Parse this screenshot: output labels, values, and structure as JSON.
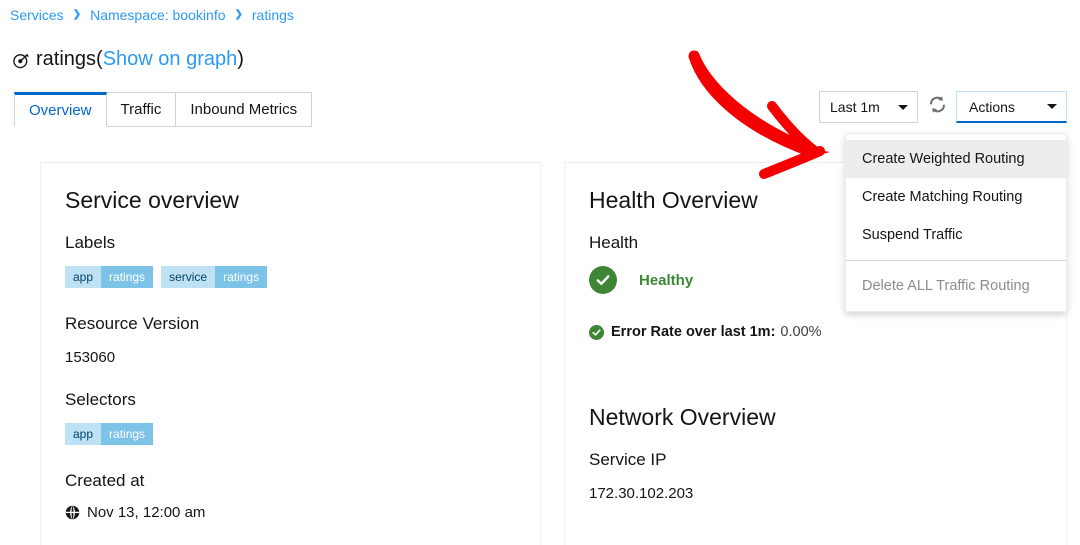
{
  "breadcrumb": {
    "items": [
      {
        "label": "Services"
      },
      {
        "label": "Namespace: bookinfo"
      },
      {
        "label": "ratings"
      }
    ],
    "separator": "❯"
  },
  "header": {
    "icon": "service-node-icon",
    "name": "ratings",
    "paren_open": "(",
    "graph_link": "Show on graph",
    "paren_close": ")"
  },
  "tabs": [
    {
      "label": "Overview",
      "active": true
    },
    {
      "label": "Traffic",
      "active": false
    },
    {
      "label": "Inbound Metrics",
      "active": false
    }
  ],
  "toolbar": {
    "time_range": "Last 1m",
    "refresh_icon": "refresh-icon",
    "actions_label": "Actions"
  },
  "actions_menu": {
    "items": [
      {
        "label": "Create Weighted Routing",
        "state": "hovered"
      },
      {
        "label": "Create Matching Routing",
        "state": "normal"
      },
      {
        "label": "Suspend Traffic",
        "state": "normal"
      },
      {
        "label": "Delete ALL Traffic Routing",
        "state": "disabled"
      }
    ]
  },
  "service_overview": {
    "title": "Service overview",
    "labels_title": "Labels",
    "labels": [
      {
        "key": "app",
        "value": "ratings"
      },
      {
        "key": "service",
        "value": "ratings"
      }
    ],
    "resource_version_title": "Resource Version",
    "resource_version": "153060",
    "selectors_title": "Selectors",
    "selectors": [
      {
        "key": "app",
        "value": "ratings"
      }
    ],
    "created_at_title": "Created at",
    "created_at": "Nov 13, 12:00 am",
    "created_at_icon": "globe-icon"
  },
  "health_overview": {
    "title": "Health Overview",
    "health_title": "Health",
    "health_status": "Healthy",
    "health_icon": "check-circle-icon",
    "error_rate_icon": "check-circle-icon",
    "error_rate_label": "Error Rate over last 1m:",
    "error_rate_value": "0.00%"
  },
  "network_overview": {
    "title": "Network Overview",
    "service_ip_title": "Service IP",
    "service_ip": "172.30.102.203"
  },
  "annotation": {
    "type": "red-arrow",
    "color": "#f50000",
    "points_to": "actions-dropdown-menu"
  },
  "colors": {
    "link": "#2b9af3",
    "tab_active": "#0066cc",
    "badge_key_bg": "#bee1f4",
    "badge_value_bg": "#7dc3e8",
    "health_green": "#3e8635",
    "annotation_red": "#f50000"
  }
}
